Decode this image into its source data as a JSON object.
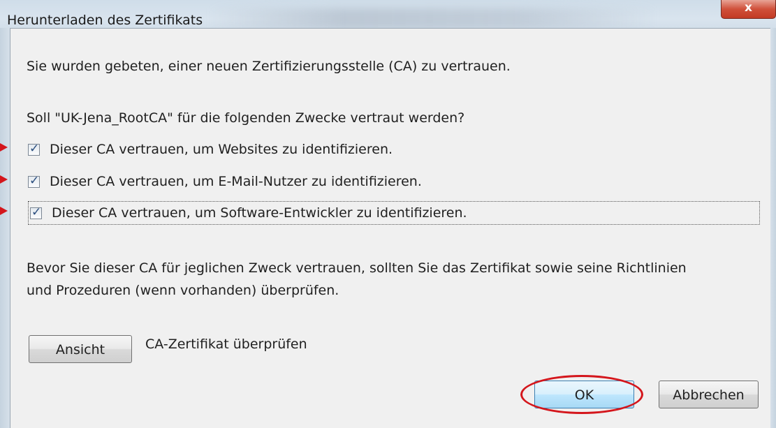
{
  "window": {
    "title": "Herunterladen des Zertifikats",
    "close_symbol": "x"
  },
  "dialog": {
    "intro": "Sie wurden gebeten, einer neuen Zertifizierungsstelle (CA) zu vertrauen.",
    "question": "Soll \"UK-Jena_RootCA\" für die folgenden Zwecke vertraut werden?",
    "checkboxes": [
      {
        "label": "Dieser CA vertrauen, um Websites zu identifizieren.",
        "checked": true
      },
      {
        "label": "Dieser CA vertrauen, um E-Mail-Nutzer zu identifizieren.",
        "checked": true
      },
      {
        "label": "Dieser CA vertrauen, um Software-Entwickler zu identifizieren.",
        "checked": true
      }
    ],
    "info_line1": "Bevor Sie dieser CA für jeglichen Zweck vertrauen, sollten Sie das Zertifikat sowie seine Richtlinien",
    "info_line2": "und Prozeduren (wenn vorhanden) überprüfen.",
    "view_button": "Ansicht",
    "view_description": "CA-Zertifikat überprüfen",
    "ok_button": "OK",
    "cancel_button": "Abbrechen",
    "check_glyph": "✓"
  },
  "annotations": {
    "highlight_color": "#d4161c"
  }
}
